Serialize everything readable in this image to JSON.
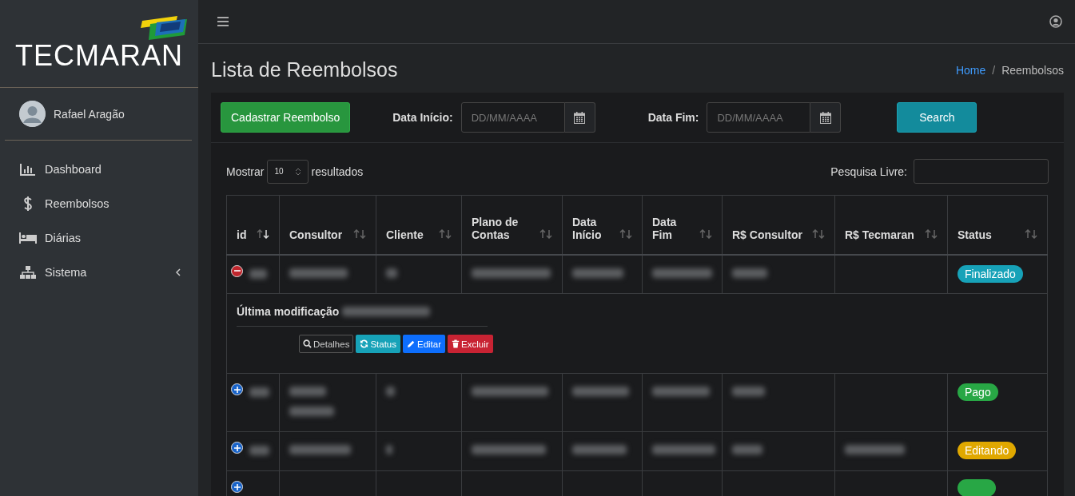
{
  "sidebar": {
    "logo": "TECMARAN",
    "user": "Rafael Aragão",
    "items": [
      {
        "label": "Dashboard",
        "selected": false
      },
      {
        "label": "Reembolsos",
        "selected": false
      },
      {
        "label": "Diárias",
        "selected": false
      },
      {
        "label": "Sistema",
        "selected": false,
        "has_children": true
      }
    ]
  },
  "breadcrumb": [
    {
      "label": "Home",
      "kind": "link"
    },
    {
      "label": "Reembolsos",
      "kind": "current"
    }
  ],
  "breadcrumb_separator": "/",
  "page_title": "Lista de Reembolsos",
  "filters": {
    "create_button": "Cadastrar Reembolso",
    "start_label": "Data Início:",
    "start_placeholder": "DD/MM/AAAA",
    "end_label": "Data Fim:",
    "end_placeholder": "DD/MM/AAAA",
    "search_button": "Search"
  },
  "length": {
    "before": "Mostrar",
    "value": "10",
    "after": "resultados"
  },
  "search": {
    "label": "Pesquisa Livre:"
  },
  "table": {
    "columns": [
      {
        "label": "id",
        "sorted": true
      },
      {
        "label": "Consultor",
        "sorted": false
      },
      {
        "label": "Cliente",
        "sorted": false
      },
      {
        "label": "Plano de Contas",
        "sorted": false
      },
      {
        "label": "Data Início",
        "sorted": false
      },
      {
        "label": "Data Fim",
        "sorted": false
      },
      {
        "label": "R$ Consultor",
        "sorted": false
      },
      {
        "label": "R$ Tecmaran",
        "sorted": false
      },
      {
        "label": "Status",
        "sorted": false
      }
    ],
    "rows": [
      {
        "expanded": true,
        "redacted": [
          true,
          true,
          true,
          true,
          true,
          true,
          true,
          false
        ],
        "status": {
          "label": "Finalizado",
          "color": "#17a2b8"
        },
        "detail": {
          "label": "Última modificação",
          "actions": [
            {
              "label": "Detalhes",
              "kind": "details"
            },
            {
              "label": "Status",
              "kind": "status"
            },
            {
              "label": "Editar",
              "kind": "edit"
            },
            {
              "label": "Excluir",
              "kind": "delete"
            }
          ]
        }
      },
      {
        "expanded": false,
        "wrapped": true,
        "redacted": [
          true,
          true,
          true,
          true,
          true,
          true,
          true,
          false
        ],
        "status": {
          "label": "Pago",
          "color": "#28a745"
        }
      },
      {
        "expanded": false,
        "redacted": [
          true,
          true,
          true,
          true,
          true,
          true,
          true,
          true
        ],
        "status": {
          "label": "Editando",
          "color": "#e0a800"
        }
      },
      {
        "expanded": false,
        "redacted": [
          false,
          false,
          false,
          false,
          false,
          false,
          false,
          false
        ],
        "status": {
          "color": "#28a745"
        }
      }
    ]
  }
}
